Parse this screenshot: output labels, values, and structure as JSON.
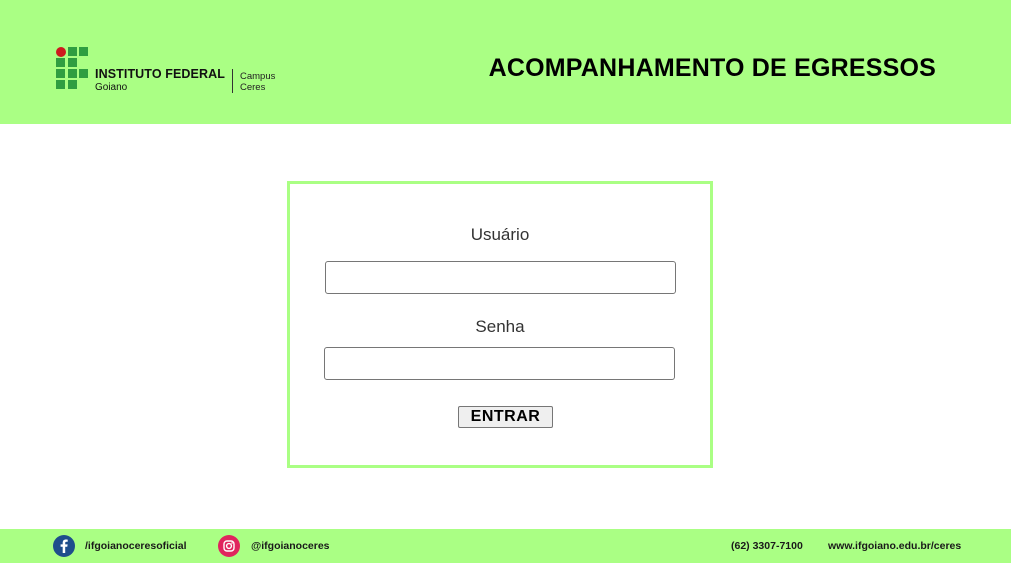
{
  "header": {
    "logo": {
      "title": "INSTITUTO FEDERAL",
      "subtitle": "Goiano",
      "campus_line1": "Campus",
      "campus_line2": "Ceres"
    },
    "app_title": "ACOMPANHAMENTO DE EGRESSOS"
  },
  "login": {
    "user_label": "Usuário",
    "user_value": "",
    "password_label": "Senha",
    "password_value": "",
    "submit_label": "ENTRAR"
  },
  "footer": {
    "facebook": "/ifgoianoceresoficial",
    "instagram": "@ifgoianoceres",
    "phone": "(62) 3307-7100",
    "website": "www.ifgoiano.edu.br/ceres"
  },
  "colors": {
    "accent_green": "#aaff84",
    "logo_green": "#2f9e41",
    "logo_red": "#cd191e",
    "facebook_blue": "#1f4e8c",
    "instagram_pink": "#e0245e"
  },
  "icons": [
    "ifgoiano-logo-icon",
    "facebook-icon",
    "instagram-icon"
  ]
}
